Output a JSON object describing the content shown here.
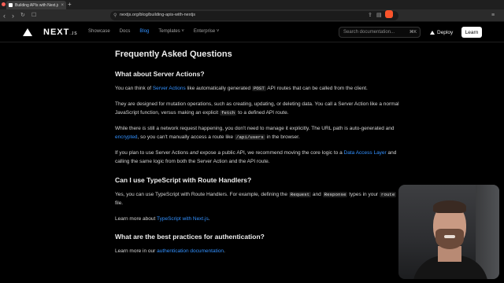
{
  "browser": {
    "tab_title": "Building APIs with Next.js | Ne",
    "url": "nextjs.org/blog/building-apis-with-nextjs",
    "colors": {
      "close": "#ff5f57",
      "minimize": "#febc2e",
      "maximize": "#28c840"
    }
  },
  "header": {
    "logo_text": "NEXT",
    "logo_suffix": ".JS",
    "nav": [
      "Showcase",
      "Docs",
      "Blog",
      "Templates ˅",
      "Enterprise ˅"
    ],
    "active_nav": "Blog",
    "search_placeholder": "Search documentation...",
    "search_shortcut": "⌘K",
    "deploy_label": "Deploy",
    "learn_label": "Learn"
  },
  "article": {
    "title": "Frequently Asked Questions",
    "faq": [
      {
        "question": "What about Server Actions?",
        "p1": {
          "a": "You can think of ",
          "link": "Server Actions",
          "b": " like automatically generated ",
          "code": "POST",
          "c": " API routes that can be called from the client."
        },
        "p2": {
          "a": "They are designed for mutation operations, such as creating, updating, or deleting data. You call a Server Action like a normal JavaScript function, versus making an explicit ",
          "code": "fetch",
          "b": " to a defined API route."
        },
        "p3": {
          "a": "While there ",
          "em": "is",
          "b": " still a network request happening, you don't need to manage it explicitly. The URL path is auto-generated and ",
          "link": "encrypted",
          "c": ", so you can't manually access a route like ",
          "code": "/api/users",
          "d": " in the browser."
        },
        "p4": {
          "a": "If you plan to use Server Actions ",
          "em": "and",
          "b": " expose a public API, we recommend moving the core logic to a ",
          "link": "Data Access Layer",
          "c": " and calling the same logic from both the Server Action and the API route."
        }
      },
      {
        "question": "Can I use TypeScript with Route Handlers?",
        "p1": {
          "a": "Yes, you can use TypeScript with Route Handlers. For example, defining the ",
          "code1": "Request",
          "b": " and ",
          "code2": "Response",
          "c": " types in your ",
          "code3": "route",
          "d": " file."
        },
        "p2": {
          "a": "Learn more about ",
          "link": "TypeScript with Next.js",
          "b": "."
        }
      },
      {
        "question": "What are the best practices for authentication?",
        "p1": {
          "a": "Learn more in our ",
          "link": "authentication documentation",
          "b": "."
        }
      }
    ]
  }
}
